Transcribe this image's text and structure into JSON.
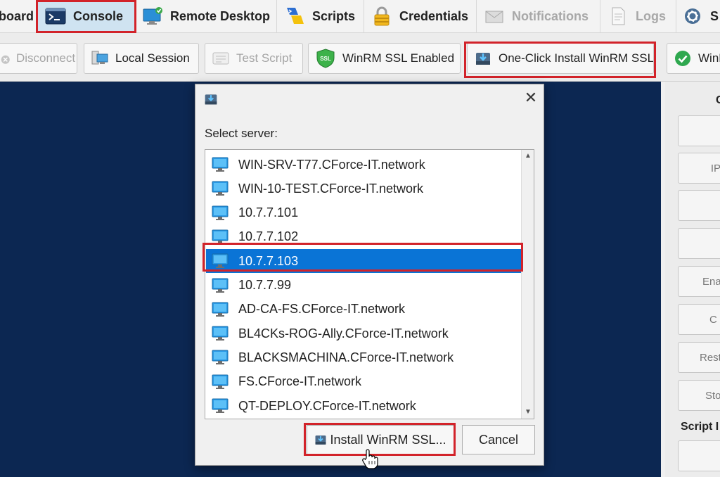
{
  "tabs": [
    {
      "label": "board",
      "icon": "dashboard-icon",
      "active": false
    },
    {
      "label": "Console",
      "icon": "console-icon",
      "active": true
    },
    {
      "label": "Remote Desktop",
      "icon": "remote-desktop-icon",
      "active": false
    },
    {
      "label": "Scripts",
      "icon": "powershell-icon",
      "active": false
    },
    {
      "label": "Credentials",
      "icon": "padlock-icon",
      "active": false
    },
    {
      "label": "Notifications",
      "icon": "envelope-icon",
      "active": false
    },
    {
      "label": "Logs",
      "icon": "document-icon",
      "active": false
    },
    {
      "label": "S",
      "icon": "gear-icon",
      "active": false
    }
  ],
  "toolbar": {
    "disconnect": "Disconnect",
    "local_session": "Local Session",
    "test_script": "Test Script",
    "winrm_ssl_enabled": "WinRM SSL Enabled",
    "ssl_badge": "SSL",
    "one_click_install": "One-Click Install WinRM SSL",
    "winrm_partial": "WinR"
  },
  "right_panel": {
    "heading_top": "C",
    "buttons": [
      "",
      "IP",
      "",
      "",
      "Ena",
      "C",
      "Rest",
      "Sto",
      ""
    ],
    "script_heading": "Script I"
  },
  "dialog": {
    "label": "Select server:",
    "close_glyph": "✕",
    "servers": [
      "WIN-SRV-T77.CForce-IT.network",
      "WIN-10-TEST.CForce-IT.network",
      "10.7.7.101",
      "10.7.7.102",
      "10.7.7.103",
      "10.7.7.99",
      "AD-CA-FS.CForce-IT.network",
      "BL4CKs-ROG-Ally.CForce-IT.network",
      "BLACKSMACHINA.CForce-IT.network",
      "FS.CForce-IT.network",
      "QT-DEPLOY.CForce-IT.network"
    ],
    "selected": "10.7.7.103",
    "install_button": "Install WinRM SSL...",
    "cancel_button": "Cancel"
  },
  "colors": {
    "highlight_outline": "#d2232a",
    "selection": "#0a74d6",
    "console_background": "#0c2752"
  }
}
